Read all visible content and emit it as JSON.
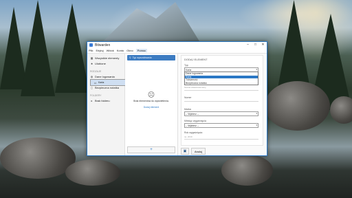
{
  "window": {
    "title": "Bitwarden",
    "minimize": "–",
    "maximize": "□",
    "close": "✕"
  },
  "menu": [
    "Plik",
    "Edytuj",
    "Widok",
    "Konto",
    "Okno",
    "Pomoc"
  ],
  "sidebar": {
    "top_items": [
      {
        "icon": "grid-icon",
        "glyph": "▦",
        "label": "Wszystkie elementy"
      },
      {
        "icon": "star-icon",
        "glyph": "★",
        "label": "Ulubione"
      }
    ],
    "types_header": "Rodzaje",
    "types": [
      {
        "icon": "globe-icon",
        "glyph": "◍",
        "label": "Dane logowania"
      },
      {
        "icon": "card-icon",
        "glyph": "▭",
        "label": "Karta",
        "selected": true
      },
      {
        "icon": "id-card-icon",
        "glyph": "▤",
        "label": "Tożsamość"
      },
      {
        "icon": "note-icon",
        "glyph": "▯",
        "label": "Bezpieczna notatka"
      }
    ],
    "folders_header": "Foldery",
    "folders": [
      {
        "icon": "folder-icon",
        "glyph": "▸",
        "label": "Brak folderu"
      }
    ]
  },
  "list": {
    "search_placeholder": "Typ wyszukiwania",
    "empty_text": "Brak elementów do wyświetlenia.",
    "add_link": "Dodaj element",
    "add_button": "+"
  },
  "edit": {
    "section_title": "Dodaj element",
    "type_label": "Typ",
    "type_value": "Karta",
    "type_options": [
      "Dane logowania",
      "Karta",
      "Tożsamość",
      "Bezpieczna notatka"
    ],
    "type_highlighted": "Karta",
    "name_hint": "Nazwa właściciela karty",
    "number_label": "Numer",
    "brand_label": "Marka",
    "brand_value": "-- Wybierz --",
    "exp_month_label": "Miesiąc wygaśnięcia",
    "exp_month_value": "-- Wybierz --",
    "exp_year_label": "Rok wygaśnięcia",
    "exp_year_hint": "np. 2019",
    "save_icon": "save-icon",
    "cancel_label": "Anuluj"
  }
}
